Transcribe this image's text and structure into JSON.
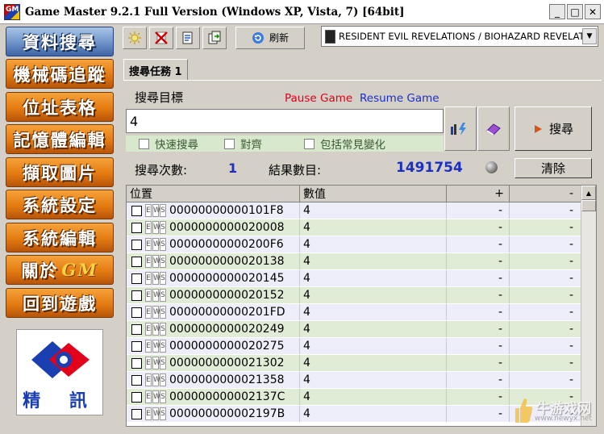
{
  "window": {
    "title": "Game Master 9.2.1 Full Version (Windows XP, Vista, 7) [64bit]",
    "icon_text": "GM",
    "controls": [
      "minimize-icon",
      "maximize-icon",
      "close-icon"
    ]
  },
  "sidebar": {
    "items": [
      {
        "label": "資料搜尋",
        "active": true
      },
      {
        "label": "機械碼追蹤",
        "active": false
      },
      {
        "label": "位址表格",
        "active": false
      },
      {
        "label": "記憶體編輯",
        "active": false
      },
      {
        "label": "擷取圖片",
        "active": false
      },
      {
        "label": "系統設定",
        "active": false
      },
      {
        "label": "系統編輯",
        "active": false
      },
      {
        "label": "關於",
        "suffix": "GM",
        "active": false
      },
      {
        "label": "回到遊戲",
        "active": false
      }
    ],
    "logo_text": "精  訊"
  },
  "toolbar": {
    "icons": [
      "new-search-icon",
      "delete-icon",
      "save-list-icon",
      "export-icon"
    ],
    "refresh_label": "刷新",
    "process_value": "RESIDENT EVIL REVELATIONS / BIOHAZARD REVELATIONS"
  },
  "tabs": [
    {
      "label": "搜尋任務 1"
    }
  ],
  "search": {
    "label": "搜尋目標",
    "pause_label": "Pause Game",
    "resume_label": "Resume Game",
    "value": "4",
    "button_label": "搜尋",
    "options": [
      {
        "label": "快速搜尋",
        "checked": false
      },
      {
        "label": "對齊",
        "checked": false
      },
      {
        "label": "包括常見變化",
        "checked": false
      }
    ]
  },
  "stats": {
    "search_count_label": "搜尋次數:",
    "search_count_value": "1",
    "result_count_label": "結果數目:",
    "result_count_value": "1491754",
    "clear_label": "清除"
  },
  "results": {
    "columns": [
      "位置",
      "數值",
      "+",
      "-"
    ],
    "flags": [
      "E",
      "W",
      "S"
    ],
    "rows": [
      {
        "address": "00000000000101F8",
        "value": "4",
        "plus": "-",
        "minus": "-"
      },
      {
        "address": "0000000000020008",
        "value": "4",
        "plus": "-",
        "minus": "-"
      },
      {
        "address": "00000000000200F6",
        "value": "4",
        "plus": "-",
        "minus": "-"
      },
      {
        "address": "0000000000020138",
        "value": "4",
        "plus": "-",
        "minus": "-"
      },
      {
        "address": "0000000000020145",
        "value": "4",
        "plus": "-",
        "minus": "-"
      },
      {
        "address": "0000000000020152",
        "value": "4",
        "plus": "-",
        "minus": "-"
      },
      {
        "address": "00000000000201FD",
        "value": "4",
        "plus": "-",
        "minus": "-"
      },
      {
        "address": "0000000000020249",
        "value": "4",
        "plus": "-",
        "minus": "-"
      },
      {
        "address": "0000000000020275",
        "value": "4",
        "plus": "-",
        "minus": "-"
      },
      {
        "address": "0000000000021302",
        "value": "4",
        "plus": "-",
        "minus": "-"
      },
      {
        "address": "0000000000021358",
        "value": "4",
        "plus": "-",
        "minus": "-"
      },
      {
        "address": "000000000002137C",
        "value": "4",
        "plus": "-",
        "minus": "-"
      },
      {
        "address": "000000000002197B",
        "value": "4",
        "plus": "-",
        "minus": "-"
      }
    ]
  },
  "watermark": {
    "text": "牛游戏网",
    "url": "www.newyx.net"
  },
  "colors": {
    "pause": "#e0001a",
    "resume": "#1c2fc4",
    "nav_orange": "#e37b10",
    "nav_active": "#6e93c8",
    "row_green": "#e1ecd6",
    "row_lavender": "#eeeefa"
  }
}
